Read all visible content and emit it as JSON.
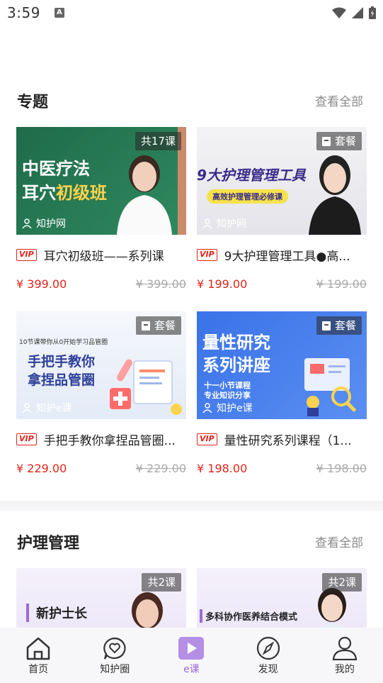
{
  "status_bar": {
    "time": "3:59",
    "notification_icon": "a-icon"
  },
  "sections": [
    {
      "title": "专题",
      "more_label": "查看全部",
      "courses": [
        {
          "title": "耳穴初级班——系列课",
          "price": "¥ 399.00",
          "original_price": "¥ 399.00",
          "badge": "共17课",
          "source": "知护网",
          "thumb_lines": [
            "中医疗法",
            "耳穴"
          ],
          "thumb_highlight": "初级班"
        },
        {
          "title": "9大护理管理工具●高...",
          "price": "¥ 199.00",
          "original_price": "¥ 199.00",
          "badge": "套餐",
          "source": "知护网",
          "thumb_lines": [
            "9大护理管理工具"
          ],
          "thumb_sub": "高效护理管理必修课"
        },
        {
          "title": "手把手教你拿捏品管圈...",
          "price": "¥ 229.00",
          "original_price": "¥ 229.00",
          "badge": "套餐",
          "source": "知护e课",
          "thumb_top": "10节课带你从0开始学习品管圈",
          "thumb_lines": [
            "手把手教你",
            "拿捏品管圈"
          ]
        },
        {
          "title": "量性研究系列课程（1...",
          "price": "¥ 198.00",
          "original_price": "¥ 198.00",
          "badge": "套餐",
          "source": "知护e课",
          "thumb_lines": [
            "量性研究",
            "系列讲座"
          ],
          "thumb_sub": "十一小节课程",
          "thumb_sub2": "专业知识分享"
        }
      ]
    },
    {
      "title": "护理管理",
      "more_label": "查看全部",
      "courses": [
        {
          "badge": "共2课",
          "thumb_lines": [
            "新护士长"
          ]
        },
        {
          "badge": "共2课",
          "thumb_lines": [
            "多科协作医养结合模式"
          ]
        }
      ]
    }
  ],
  "vip_label": "VIP",
  "tabbar": [
    {
      "label": "首页",
      "icon": "home-icon"
    },
    {
      "label": "知护圈",
      "icon": "heart-chat-icon"
    },
    {
      "label": "e课",
      "icon": "play-icon",
      "active": true
    },
    {
      "label": "发现",
      "icon": "compass-icon"
    },
    {
      "label": "我的",
      "icon": "user-icon"
    }
  ]
}
